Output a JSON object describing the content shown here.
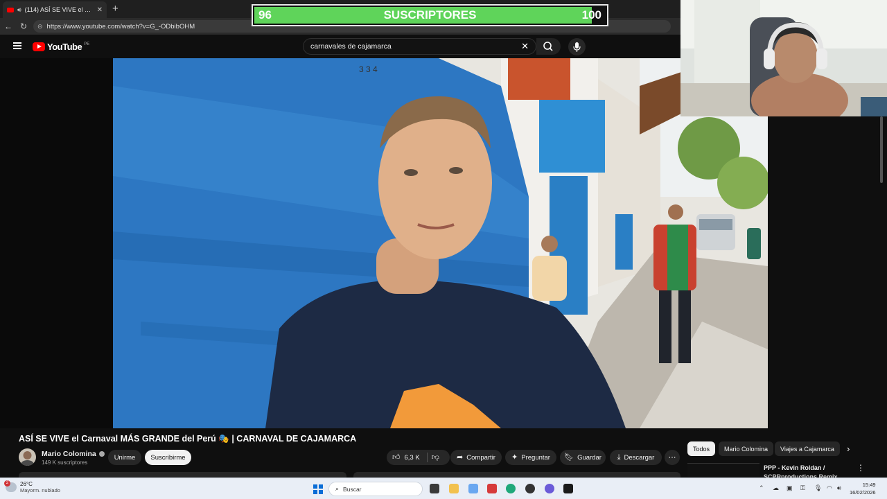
{
  "browser": {
    "tab_title": "(114) ASÍ SE VIVE el Carnaval",
    "url": "https://www.youtube.com/watch?v=G_-ODbibOHM",
    "colors": {
      "tabbar": "#1f1f1f",
      "tab": "#2b2b2b"
    }
  },
  "overlay": {
    "current": "96",
    "label": "SUSCRIPTORES",
    "goal": "100",
    "progress_fraction": 0.96,
    "fill_color": "#5fd45a"
  },
  "youtube": {
    "logo_text": "YouTube",
    "region": "PE",
    "search_query": "carnavales de cajamarca",
    "brand_color": "#ff0000"
  },
  "video": {
    "title": "ASÍ SE VIVE el Carnaval MÁS GRANDE del Perú 🎭 | CARNAVAL DE CAJAMARCA",
    "channel": "Mario Colomina",
    "subscribers": "149 K suscriptores",
    "join_label": "Unirme",
    "subscribe_label": "Suscribirme",
    "likes": "6,3 K",
    "share_label": "Compartir",
    "ask_label": "Preguntar",
    "save_label": "Guardar",
    "download_label": "Descargar"
  },
  "sidebar": {
    "chips": [
      "Todos",
      "Mario Colomina",
      "Viajes a Cajamarca"
    ],
    "rec_title": "PPP - Kevin Roldan /",
    "rec_sub": "SCPRproductions Remix"
  },
  "taskbar": {
    "weather_temp": "26°C",
    "weather_desc": "Mayorm. nublado",
    "weather_badge": "2",
    "search_label": "Buscar",
    "time": "15:49",
    "date": "16/02/2026",
    "accent": "#0a6dd6"
  }
}
